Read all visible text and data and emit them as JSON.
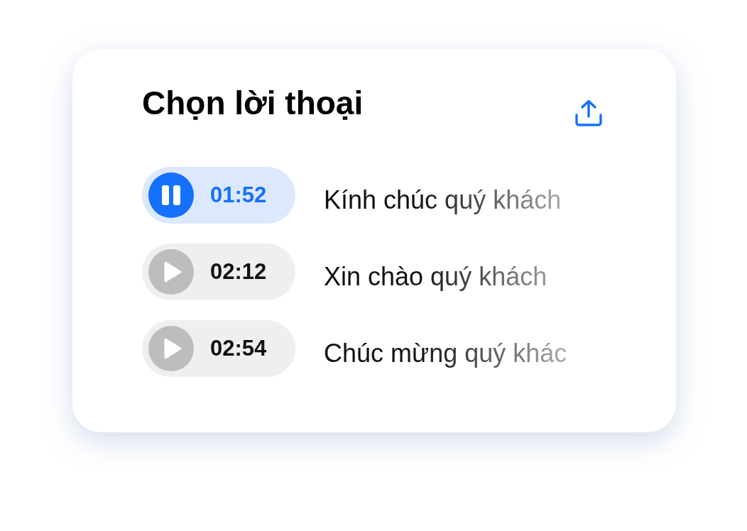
{
  "card": {
    "title": "Chọn lời thoại",
    "tracks": [
      {
        "duration": "01:52",
        "text": "Kính chúc quý khách",
        "playing": true
      },
      {
        "duration": "02:12",
        "text": "Xin chào quý khách",
        "playing": false
      },
      {
        "duration": "02:54",
        "text": "Chúc mừng quý khác",
        "playing": false
      }
    ]
  }
}
